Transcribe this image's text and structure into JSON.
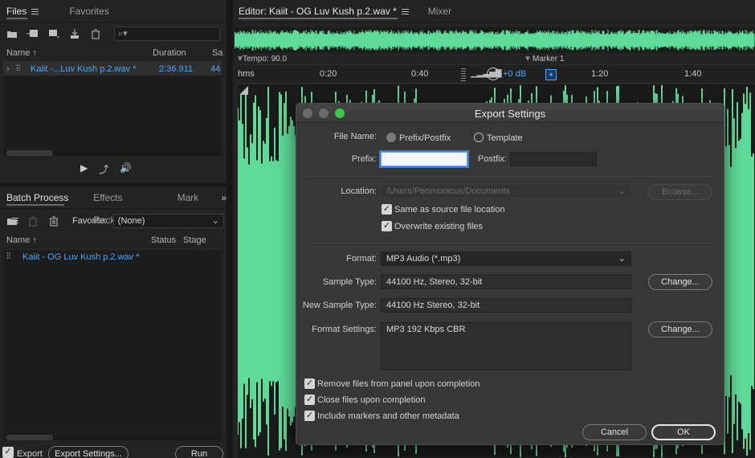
{
  "files_panel": {
    "tabs": [
      "Files",
      "Favorites"
    ],
    "search_placeholder": "⌕▾",
    "columns": [
      "Name ↑",
      "Duration",
      "Sa"
    ],
    "rows": [
      {
        "name": "Kaiit -...Luv Kush p.2.wav *",
        "duration": "2:36.911",
        "extra": "44"
      }
    ],
    "transport": [
      "▶",
      "⤴",
      "🔊"
    ]
  },
  "batch_panel": {
    "tabs": [
      "Batch Process",
      "Effects Rack",
      "Mark"
    ],
    "favorite_label": "Favorite:",
    "favorite_value": "(None)",
    "columns": [
      "Name ↑",
      "Status",
      "Stage"
    ],
    "rows": [
      {
        "name": "Kaiit - OG Luv Kush p.2.wav *"
      }
    ],
    "export_checkbox_label": "Export",
    "export_settings_button": "Export Settings...",
    "run_button": "Run"
  },
  "editor": {
    "tabs": [
      "Editor: Kaiit - OG Luv Kush p.2.wav *",
      "Mixer"
    ],
    "tempo": "Tempo: 90.0",
    "marker": "Marker 1",
    "ruler_unit": "hms",
    "ruler_ticks": [
      "0:20",
      "0:40",
      "1:20",
      "1:40"
    ],
    "volume": "+0 dB",
    "wave_color": "#5fdb99"
  },
  "dialog": {
    "title": "Export Settings",
    "file_name_label": "File Name:",
    "file_name_options": [
      "Prefix/Postfix",
      "Template"
    ],
    "prefix_label": "Prefix:",
    "prefix_value": "",
    "postfix_label": "Postfix:",
    "postfix_value": "",
    "location_label": "Location:",
    "location_value": "/Users/Penmonicus/Documents",
    "browse_button": "Browse...",
    "same_as_source_label": "Same as source file location",
    "overwrite_label": "Overwrite existing files",
    "format_label": "Format:",
    "format_value": "MP3 Audio (*.mp3)",
    "sample_type_label": "Sample Type:",
    "sample_type_value": "44100 Hz, Stereo, 32-bit",
    "new_sample_type_label": "New Sample Type:",
    "new_sample_type_value": "44100 Hz Stereo, 32-bit",
    "format_settings_label": "Format Settings:",
    "format_settings_value": "MP3 192 Kbps CBR",
    "change_button": "Change...",
    "remove_files_label": "Remove files from panel upon completion",
    "close_files_label": "Close files upon completion",
    "include_markers_label": "Include markers and other metadata",
    "cancel_button": "Cancel",
    "ok_button": "OK"
  }
}
